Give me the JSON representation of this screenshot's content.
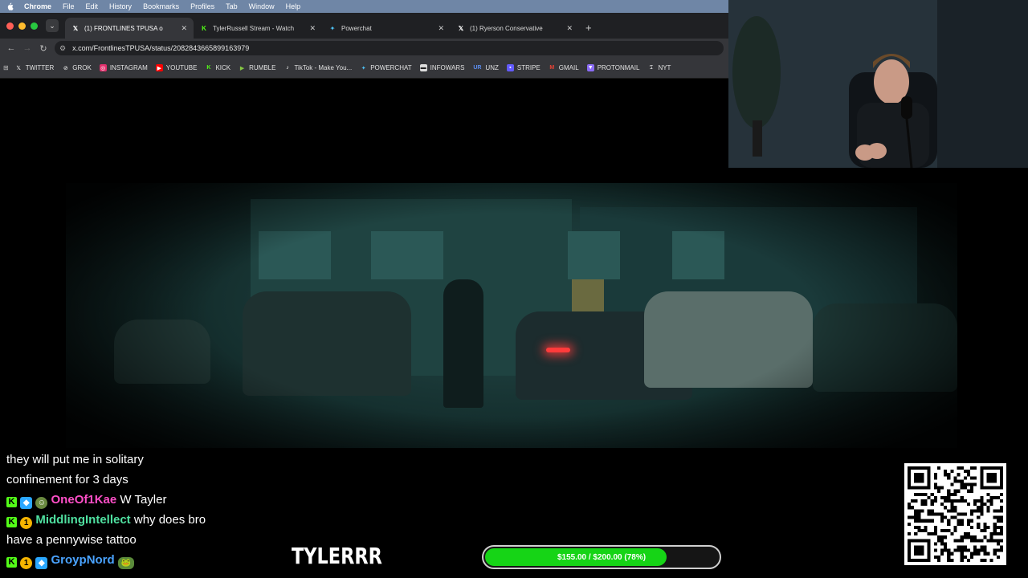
{
  "menubar": {
    "app": "Chrome",
    "items": [
      "File",
      "Edit",
      "History",
      "Bookmarks",
      "Profiles",
      "Tab",
      "Window",
      "Help"
    ]
  },
  "tabs": [
    {
      "icon": "x-logo-icon",
      "title": "(1) FRONTLINES TPUSA o",
      "active": true
    },
    {
      "icon": "kick-logo-icon",
      "title": "TylerRussell Stream - Watch",
      "active": false
    },
    {
      "icon": "powerchat-icon",
      "title": "Powerchat",
      "active": false
    },
    {
      "icon": "x-logo-icon",
      "title": "(1) Ryerson Conservative",
      "active": false
    }
  ],
  "address": {
    "url": "x.com/FrontlinesTPUSA/status/2082843665899163979"
  },
  "bookmarks": [
    {
      "label": "TWITTER",
      "icon": "x-logo-icon",
      "color": "#ffffff"
    },
    {
      "label": "GROK",
      "icon": "grok-icon",
      "color": "#ffffff"
    },
    {
      "label": "INSTAGRAM",
      "icon": "instagram-icon",
      "color": "#e1306c"
    },
    {
      "label": "YOUTUBE",
      "icon": "youtube-icon",
      "color": "#ff0000"
    },
    {
      "label": "KICK",
      "icon": "kick-logo-icon",
      "color": "#53fc18"
    },
    {
      "label": "RUMBLE",
      "icon": "rumble-icon",
      "color": "#85c742"
    },
    {
      "label": "TikTok - Make You...",
      "icon": "tiktok-icon",
      "color": "#ffffff"
    },
    {
      "label": "POWERCHAT",
      "icon": "powerchat-icon",
      "color": "#4fc3f7"
    },
    {
      "label": "INFOWARS",
      "icon": "infowars-icon",
      "color": "#ffffff"
    },
    {
      "label": "UNZ",
      "icon": "unz-icon",
      "color": "#5b8def"
    },
    {
      "label": "STRIPE",
      "icon": "stripe-icon",
      "color": "#635bff"
    },
    {
      "label": "GMAIL",
      "icon": "gmail-icon",
      "color": "#ea4335"
    },
    {
      "label": "PROTONMAIL",
      "icon": "protonmail-icon",
      "color": "#8b6cf7"
    },
    {
      "label": "NYT",
      "icon": "nyt-icon",
      "color": "#ffffff"
    }
  ],
  "chat": {
    "messages": [
      {
        "user": "",
        "text": "they will put me in solitary",
        "continuation": true
      },
      {
        "user": "",
        "text": "confinement for 3 days",
        "continuation": true
      },
      {
        "user": "OneOf1Kae",
        "text": "W Tayler",
        "color": "#ff4fc8"
      },
      {
        "user": "MiddlingIntellect",
        "text": "why does bro",
        "color": "#4fe0a0"
      },
      {
        "user": "",
        "text": "have a pennywise tattoo",
        "continuation": true
      },
      {
        "user": "GroypNord",
        "text": "",
        "color": "#4aa3ff"
      }
    ]
  },
  "overlay": {
    "brand": "TYLERRR",
    "goal_text": "$155.00 / $200.00 (78%)",
    "goal_fraction": 0.78,
    "goal_color": "#16d416"
  }
}
